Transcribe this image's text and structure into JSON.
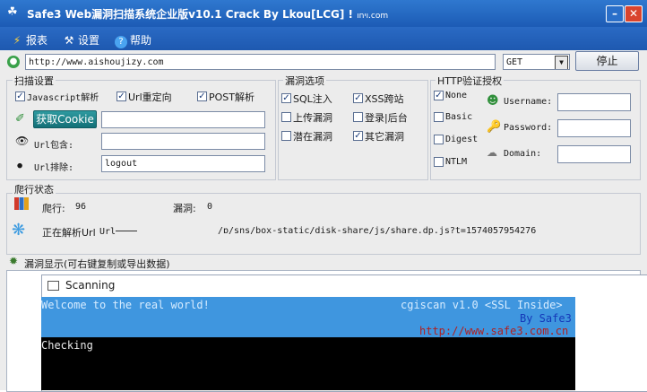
{
  "window": {
    "title": "Safe3 Web漏洞扫描系统企业版v10.1   Crack  By  Lkou[LCG]  !   ",
    "title_tail": "ויחו.com"
  },
  "menu": [
    {
      "label": "报表",
      "icon": "lightning-icon"
    },
    {
      "label": "设置",
      "icon": "tools-icon"
    },
    {
      "label": "帮助",
      "icon": "help-icon"
    }
  ],
  "url_bar": {
    "value": "http://www.aishoujizy.com",
    "method": "GET",
    "stop_label": "停止"
  },
  "scan_settings": {
    "legend": "扫描设置",
    "javascript_label": "Javascript解析",
    "url_redirect_label": "Url重定向",
    "post_label": "POST解析",
    "get_cookie_label": "获取Cookie",
    "cookie_value": "",
    "url_include_label": "Url包含:",
    "url_include_value": "",
    "url_exclude_label": "Url排除:",
    "url_exclude_value": "logout"
  },
  "vuln_options": {
    "legend": "漏洞选项",
    "items": [
      {
        "label": "SQL注入",
        "checked": true
      },
      {
        "label": "XSS跨站",
        "checked": true
      },
      {
        "label": "上传漏洞",
        "checked": false
      },
      {
        "label": "登录|后台",
        "checked": false
      },
      {
        "label": "潜在漏洞",
        "checked": false
      },
      {
        "label": "其它漏洞",
        "checked": true
      }
    ]
  },
  "http_auth": {
    "legend": "HTTP验证授权",
    "options": [
      {
        "label": "None",
        "checked": true
      },
      {
        "label": "Basic",
        "checked": false
      },
      {
        "label": "Digest",
        "checked": false
      },
      {
        "label": "NTLM",
        "checked": false
      }
    ],
    "username_label": "Username:",
    "password_label": "Password:",
    "domain_label": "Domain:"
  },
  "crawl_status": {
    "legend": "爬行状态",
    "crawl_label": "爬行:",
    "crawl_count": "96",
    "vuln_label": "漏洞:",
    "vuln_count": "0",
    "parsing_label": "正在解析Url",
    "parsing_url_label": "Url",
    "parsing_path": "/ɒ/sns/box-static/disk-share/js/share.dp.js?t=1574057954276"
  },
  "vuln_display": {
    "label": "漏洞显示(可右键复制或导出数据)"
  },
  "scanning_window": {
    "title": "Scanning",
    "welcome": "Welcome to the real world!",
    "version": "cgiscan v1.0  <SSL Inside>",
    "by": "By Safe3",
    "site": "http://www.safe3.com.cn",
    "checking": "Checking"
  }
}
